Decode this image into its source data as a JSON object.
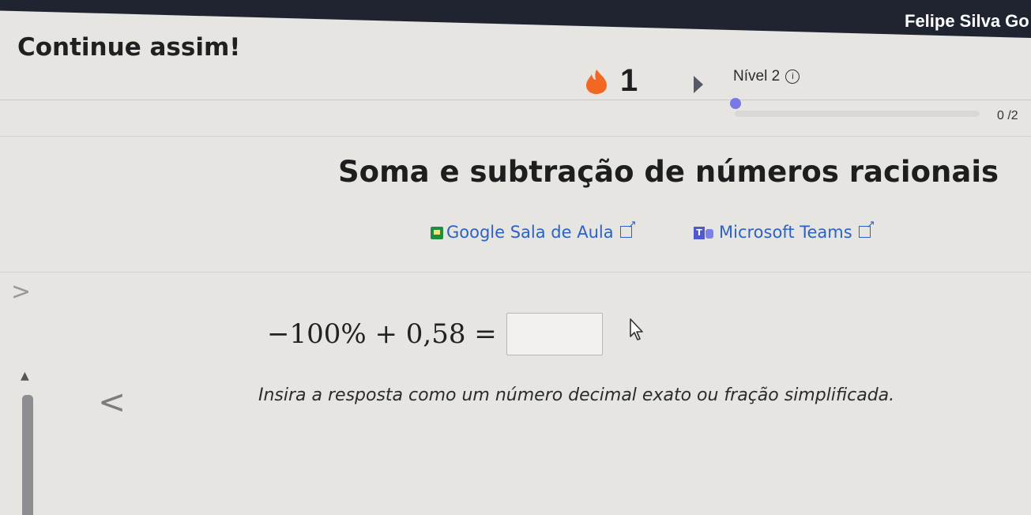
{
  "header": {
    "user_name": "Felipe Silva Go"
  },
  "banner": {
    "message": "Continue assim!"
  },
  "streak": {
    "count": "1",
    "icon": "flame-icon",
    "color": "#f26722"
  },
  "level": {
    "label": "Nível 2",
    "info_glyph": "i"
  },
  "progress": {
    "text": "0 /2",
    "fraction": 0,
    "accent": "#7a77e8"
  },
  "exercise": {
    "title": "Soma e subtração de números racionais",
    "equation": "−100% + 0,58 =",
    "answer_value": "",
    "hint": "Insira a resposta como um número decimal exato ou fração simplificada."
  },
  "share": {
    "classroom_label": "Google Sala de Aula",
    "teams_label": "Microsoft Teams",
    "link_color": "#2d62c4"
  },
  "nav": {
    "prev_glyph": "<",
    "side_glyph": ">"
  }
}
